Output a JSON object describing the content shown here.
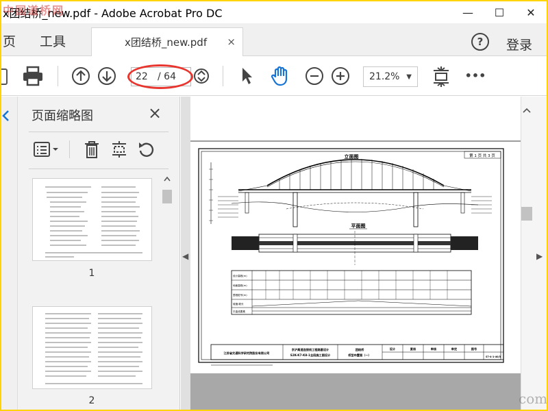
{
  "window": {
    "title": "x团结桥_new.pdf - Adobe Acrobat Pro DC",
    "minimize": "—",
    "maximize": "☐",
    "close": "✕"
  },
  "watermark": {
    "top_left": "中国道桥网",
    "bottom_right": "com"
  },
  "tabs": {
    "home": "页",
    "tools": "工具",
    "document": "x团结桥_new.pdf",
    "close_tab": "×",
    "help": "?",
    "login": "登录"
  },
  "toolbar": {
    "page_current": "22",
    "page_total": "/ 64",
    "zoom": "21.2%",
    "more": "•••"
  },
  "thumbnail_panel": {
    "title": "页面缩略图",
    "close": "×",
    "pages": [
      {
        "number": "1"
      },
      {
        "number": "2"
      }
    ]
  },
  "drawing": {
    "title_elevation": "立面图",
    "title_plan": "平面图",
    "page_label": "第 1 页 共 3 页",
    "company": "江苏省交通科学研究院股份有限公司",
    "project_line1": "京沪高速连接线工程路基设计",
    "project_line2": "S2K-K7-K8-1全段施工图设计",
    "drawing_name_line1": "团结桥",
    "drawing_name_line2": "桥型布置图（一）",
    "sign_design": "设计",
    "sign_review": "复核",
    "sign_check": "审核",
    "sign_approve": "审定",
    "sign_figno": "图号",
    "figno_value": "S7-4-1-40/3",
    "row_labels": [
      "设计高程(m)",
      "地面高程(m)",
      "里程桩号(m)",
      "坡度/坡长",
      "平曲线要素"
    ]
  },
  "colors": {
    "accent_red": "#e8352e",
    "background": "#ffd400"
  }
}
